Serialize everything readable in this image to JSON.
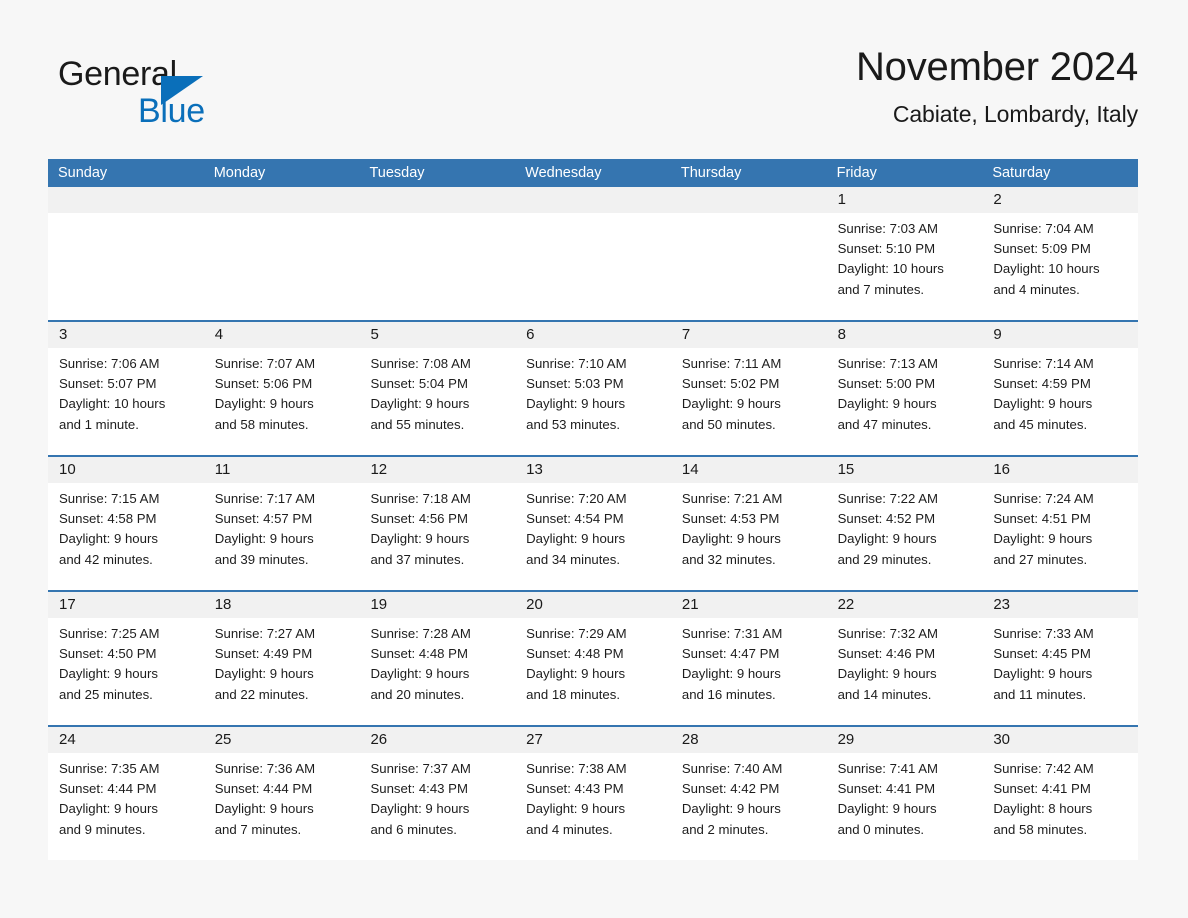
{
  "brand": {
    "name_part1": "General",
    "name_part2": "Blue",
    "triangle_color": "#0a6fba"
  },
  "header": {
    "title": "November 2024",
    "subtitle": "Cabiate, Lombardy, Italy"
  },
  "colors": {
    "header_blue": "#3575b0",
    "row_divider_blue": "#3575b0",
    "day_band_gray": "#f1f1f1",
    "page_background": "#f7f7f7",
    "text": "#1a1a1a"
  },
  "weekdays": [
    "Sunday",
    "Monday",
    "Tuesday",
    "Wednesday",
    "Thursday",
    "Friday",
    "Saturday"
  ],
  "labels": {
    "sunrise": "Sunrise:",
    "sunset": "Sunset:",
    "daylight": "Daylight:"
  },
  "weeks": [
    [
      {
        "day": "",
        "empty": true
      },
      {
        "day": "",
        "empty": true
      },
      {
        "day": "",
        "empty": true
      },
      {
        "day": "",
        "empty": true
      },
      {
        "day": "",
        "empty": true
      },
      {
        "day": "1",
        "sunrise": "Sunrise: 7:03 AM",
        "sunset": "Sunset: 5:10 PM",
        "daylight1": "Daylight: 10 hours",
        "daylight2": "and 7 minutes."
      },
      {
        "day": "2",
        "sunrise": "Sunrise: 7:04 AM",
        "sunset": "Sunset: 5:09 PM",
        "daylight1": "Daylight: 10 hours",
        "daylight2": "and 4 minutes."
      }
    ],
    [
      {
        "day": "3",
        "sunrise": "Sunrise: 7:06 AM",
        "sunset": "Sunset: 5:07 PM",
        "daylight1": "Daylight: 10 hours",
        "daylight2": "and 1 minute."
      },
      {
        "day": "4",
        "sunrise": "Sunrise: 7:07 AM",
        "sunset": "Sunset: 5:06 PM",
        "daylight1": "Daylight: 9 hours",
        "daylight2": "and 58 minutes."
      },
      {
        "day": "5",
        "sunrise": "Sunrise: 7:08 AM",
        "sunset": "Sunset: 5:04 PM",
        "daylight1": "Daylight: 9 hours",
        "daylight2": "and 55 minutes."
      },
      {
        "day": "6",
        "sunrise": "Sunrise: 7:10 AM",
        "sunset": "Sunset: 5:03 PM",
        "daylight1": "Daylight: 9 hours",
        "daylight2": "and 53 minutes."
      },
      {
        "day": "7",
        "sunrise": "Sunrise: 7:11 AM",
        "sunset": "Sunset: 5:02 PM",
        "daylight1": "Daylight: 9 hours",
        "daylight2": "and 50 minutes."
      },
      {
        "day": "8",
        "sunrise": "Sunrise: 7:13 AM",
        "sunset": "Sunset: 5:00 PM",
        "daylight1": "Daylight: 9 hours",
        "daylight2": "and 47 minutes."
      },
      {
        "day": "9",
        "sunrise": "Sunrise: 7:14 AM",
        "sunset": "Sunset: 4:59 PM",
        "daylight1": "Daylight: 9 hours",
        "daylight2": "and 45 minutes."
      }
    ],
    [
      {
        "day": "10",
        "sunrise": "Sunrise: 7:15 AM",
        "sunset": "Sunset: 4:58 PM",
        "daylight1": "Daylight: 9 hours",
        "daylight2": "and 42 minutes."
      },
      {
        "day": "11",
        "sunrise": "Sunrise: 7:17 AM",
        "sunset": "Sunset: 4:57 PM",
        "daylight1": "Daylight: 9 hours",
        "daylight2": "and 39 minutes."
      },
      {
        "day": "12",
        "sunrise": "Sunrise: 7:18 AM",
        "sunset": "Sunset: 4:56 PM",
        "daylight1": "Daylight: 9 hours",
        "daylight2": "and 37 minutes."
      },
      {
        "day": "13",
        "sunrise": "Sunrise: 7:20 AM",
        "sunset": "Sunset: 4:54 PM",
        "daylight1": "Daylight: 9 hours",
        "daylight2": "and 34 minutes."
      },
      {
        "day": "14",
        "sunrise": "Sunrise: 7:21 AM",
        "sunset": "Sunset: 4:53 PM",
        "daylight1": "Daylight: 9 hours",
        "daylight2": "and 32 minutes."
      },
      {
        "day": "15",
        "sunrise": "Sunrise: 7:22 AM",
        "sunset": "Sunset: 4:52 PM",
        "daylight1": "Daylight: 9 hours",
        "daylight2": "and 29 minutes."
      },
      {
        "day": "16",
        "sunrise": "Sunrise: 7:24 AM",
        "sunset": "Sunset: 4:51 PM",
        "daylight1": "Daylight: 9 hours",
        "daylight2": "and 27 minutes."
      }
    ],
    [
      {
        "day": "17",
        "sunrise": "Sunrise: 7:25 AM",
        "sunset": "Sunset: 4:50 PM",
        "daylight1": "Daylight: 9 hours",
        "daylight2": "and 25 minutes."
      },
      {
        "day": "18",
        "sunrise": "Sunrise: 7:27 AM",
        "sunset": "Sunset: 4:49 PM",
        "daylight1": "Daylight: 9 hours",
        "daylight2": "and 22 minutes."
      },
      {
        "day": "19",
        "sunrise": "Sunrise: 7:28 AM",
        "sunset": "Sunset: 4:48 PM",
        "daylight1": "Daylight: 9 hours",
        "daylight2": "and 20 minutes."
      },
      {
        "day": "20",
        "sunrise": "Sunrise: 7:29 AM",
        "sunset": "Sunset: 4:48 PM",
        "daylight1": "Daylight: 9 hours",
        "daylight2": "and 18 minutes."
      },
      {
        "day": "21",
        "sunrise": "Sunrise: 7:31 AM",
        "sunset": "Sunset: 4:47 PM",
        "daylight1": "Daylight: 9 hours",
        "daylight2": "and 16 minutes."
      },
      {
        "day": "22",
        "sunrise": "Sunrise: 7:32 AM",
        "sunset": "Sunset: 4:46 PM",
        "daylight1": "Daylight: 9 hours",
        "daylight2": "and 14 minutes."
      },
      {
        "day": "23",
        "sunrise": "Sunrise: 7:33 AM",
        "sunset": "Sunset: 4:45 PM",
        "daylight1": "Daylight: 9 hours",
        "daylight2": "and 11 minutes."
      }
    ],
    [
      {
        "day": "24",
        "sunrise": "Sunrise: 7:35 AM",
        "sunset": "Sunset: 4:44 PM",
        "daylight1": "Daylight: 9 hours",
        "daylight2": "and 9 minutes."
      },
      {
        "day": "25",
        "sunrise": "Sunrise: 7:36 AM",
        "sunset": "Sunset: 4:44 PM",
        "daylight1": "Daylight: 9 hours",
        "daylight2": "and 7 minutes."
      },
      {
        "day": "26",
        "sunrise": "Sunrise: 7:37 AM",
        "sunset": "Sunset: 4:43 PM",
        "daylight1": "Daylight: 9 hours",
        "daylight2": "and 6 minutes."
      },
      {
        "day": "27",
        "sunrise": "Sunrise: 7:38 AM",
        "sunset": "Sunset: 4:43 PM",
        "daylight1": "Daylight: 9 hours",
        "daylight2": "and 4 minutes."
      },
      {
        "day": "28",
        "sunrise": "Sunrise: 7:40 AM",
        "sunset": "Sunset: 4:42 PM",
        "daylight1": "Daylight: 9 hours",
        "daylight2": "and 2 minutes."
      },
      {
        "day": "29",
        "sunrise": "Sunrise: 7:41 AM",
        "sunset": "Sunset: 4:41 PM",
        "daylight1": "Daylight: 9 hours",
        "daylight2": "and 0 minutes."
      },
      {
        "day": "30",
        "sunrise": "Sunrise: 7:42 AM",
        "sunset": "Sunset: 4:41 PM",
        "daylight1": "Daylight: 8 hours",
        "daylight2": "and 58 minutes."
      }
    ]
  ]
}
